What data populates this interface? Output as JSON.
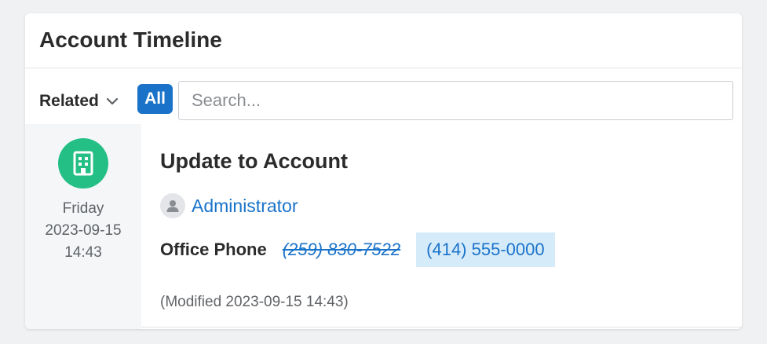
{
  "header": {
    "title": "Account Timeline"
  },
  "toolbar": {
    "related_label": "Related",
    "all_label": "All",
    "search_placeholder": "Search..."
  },
  "entry": {
    "icon": "building-icon",
    "day": "Friday",
    "date": "2023-09-15",
    "time": "14:43",
    "title": "Update to Account",
    "author": "Administrator",
    "field_label": "Office Phone",
    "old_value": "(259) 830-7522",
    "new_value": "(414) 555-0000",
    "modified": "(Modified 2023-09-15 14:43)"
  },
  "colors": {
    "accent": "#1a73c9",
    "icon_bg": "#24bf84",
    "highlight": "#d6ebfa"
  }
}
